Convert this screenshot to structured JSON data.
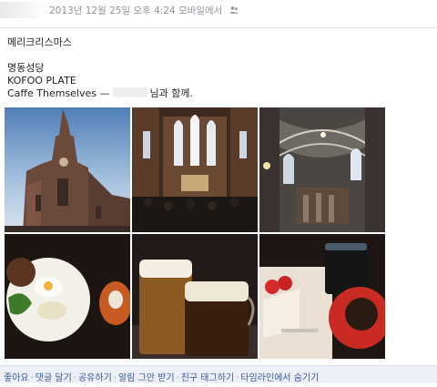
{
  "post": {
    "timestamp": "2013년 12월 25일 오후 4:24 모바일에서",
    "audience_icon": "people-icon",
    "text_line1": "메리크리스마스",
    "text_line2": "명동성당",
    "text_line3": "KOFOO PLATE",
    "text_line4_prefix": "Caffe Themselves —",
    "text_line4_suffix": "님과 함께."
  },
  "photos": [
    {
      "subject": "cathedral exterior with spire"
    },
    {
      "subject": "cathedral interior nave"
    },
    {
      "subject": "gothic vaulted ceiling"
    },
    {
      "subject": "plate of food"
    },
    {
      "subject": "two glasses of beer"
    },
    {
      "subject": "strawberry cake and coffee"
    }
  ],
  "actions": [
    {
      "label": "좋아요"
    },
    {
      "label": "댓글 달기"
    },
    {
      "label": "공유하기"
    },
    {
      "label": "알림 그만 받기"
    },
    {
      "label": "친구 태그하기"
    },
    {
      "label": "타임라인에서 숨기기"
    }
  ],
  "colors": {
    "link": "#3b5998",
    "meta": "#90949c",
    "action_bar": "#eceff5"
  }
}
